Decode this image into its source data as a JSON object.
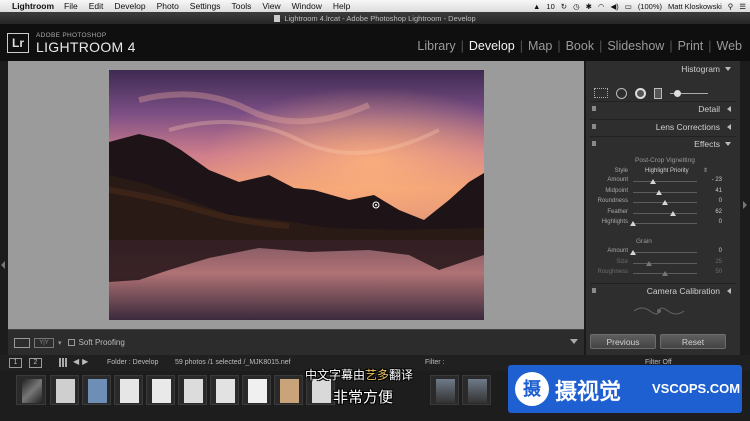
{
  "menubar": {
    "app": "Lightroom",
    "items": [
      "File",
      "Edit",
      "Develop",
      "Photo",
      "Settings",
      "Tools",
      "View",
      "Window",
      "Help"
    ],
    "status": "10",
    "battery": "(100%)",
    "user": "Matt Kloskowski"
  },
  "window": {
    "title": "Lightroom 4.lrcat - Adobe Photoshop Lightroom - Develop"
  },
  "identity": {
    "logo": "Lr",
    "small": "ADOBE PHOTOSHOP",
    "big": "LIGHTROOM 4"
  },
  "modules": [
    "Library",
    "Develop",
    "Map",
    "Book",
    "Slideshow",
    "Print",
    "Web"
  ],
  "toolbar": {
    "soft_proofing": "Soft Proofing"
  },
  "right_panel": {
    "histogram": "Histogram",
    "detail": "Detail",
    "lens": "Lens Corrections",
    "effects": "Effects",
    "vignette_title": "Post-Crop Vignetting",
    "style_label": "Style",
    "style_value": "Highlight Priority",
    "vignette_sliders": [
      {
        "label": "Amount",
        "value": "- 23",
        "pos": 0.31
      },
      {
        "label": "Midpoint",
        "value": "41",
        "pos": 0.41
      },
      {
        "label": "Roundness",
        "value": "0",
        "pos": 0.5
      },
      {
        "label": "Feather",
        "value": "62",
        "pos": 0.62
      },
      {
        "label": "Highlights",
        "value": "0",
        "pos": 0.0
      }
    ],
    "grain_title": "Grain",
    "grain_sliders": [
      {
        "label": "Amount",
        "value": "0",
        "pos": 0.0
      },
      {
        "label": "Size",
        "value": "25",
        "pos": 0.25
      },
      {
        "label": "Roughness",
        "value": "50",
        "pos": 0.5
      }
    ],
    "camera": "Camera Calibration",
    "previous": "Previous",
    "reset": "Reset"
  },
  "filmstrip": {
    "num1": "1",
    "num2": "2",
    "folder": "Folder : Develop",
    "count": "59 photos /1 selected /_MJK8015.nef",
    "filter": "Filter :",
    "filter_value": "Filter Off"
  },
  "subtitle": {
    "line1_a": "中文字幕由",
    "line1_b": "艺多",
    "line1_c": "翻译",
    "line2": "非常方便"
  },
  "watermark": {
    "icon": "摄",
    "cn": "摄视觉",
    "en": "VSCOPS.COM"
  },
  "colors": {
    "accent": "#1e5fd2",
    "panel": "#2e2e2e",
    "canvas": "#9b9b9b"
  }
}
